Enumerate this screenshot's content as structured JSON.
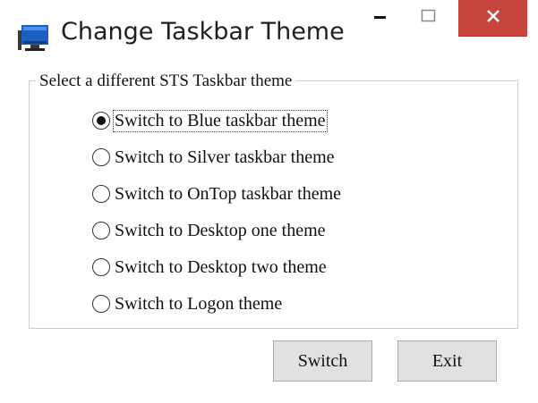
{
  "window": {
    "title": "Change Taskbar Theme",
    "icon": "monitor-icon",
    "controls": {
      "minimize": "minimize-icon",
      "maximize": "maximize-icon",
      "close": "close-icon",
      "close_color": "#c7453d"
    }
  },
  "group": {
    "legend": "Select a different STS Taskbar theme",
    "options": [
      {
        "label": "Switch to Blue taskbar theme",
        "checked": true
      },
      {
        "label": "Switch to Silver taskbar theme",
        "checked": false
      },
      {
        "label": "Switch to OnTop taskbar theme",
        "checked": false
      },
      {
        "label": "Switch to Desktop one theme",
        "checked": false
      },
      {
        "label": "Switch to Desktop two theme",
        "checked": false
      },
      {
        "label": "Switch to Logon theme",
        "checked": false
      }
    ]
  },
  "buttons": {
    "switch_label": "Switch",
    "exit_label": "Exit"
  }
}
